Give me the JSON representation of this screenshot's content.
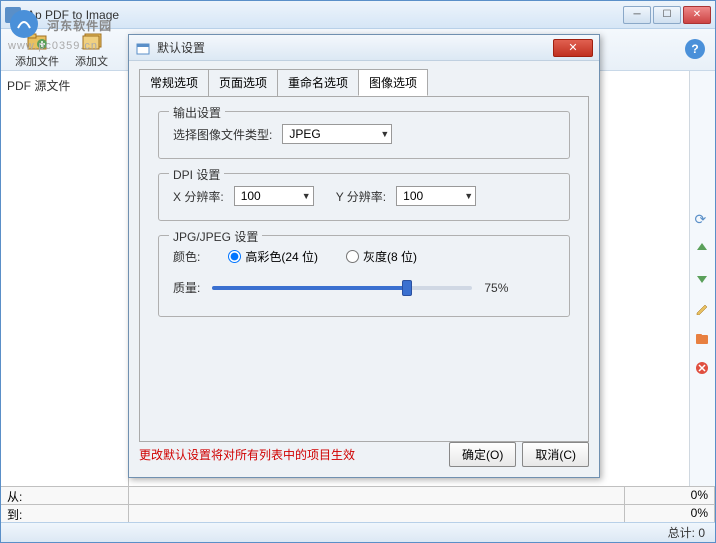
{
  "watermark": "河东软件园",
  "watermark_url": "www.pc0359.cn",
  "main": {
    "title": "Ap PDF to Image",
    "toolbar": {
      "add_file": "添加文件",
      "add_files": "添加文"
    },
    "left_header": "PDF 源文件",
    "status": {
      "from": "从:",
      "to": "到:",
      "pct": "0%",
      "total": "总计: 0"
    }
  },
  "side_icons": {
    "refresh": "refresh-icon",
    "up": "up-icon",
    "down": "down-icon",
    "edit": "edit-icon",
    "folder": "folder-icon",
    "delete": "delete-icon"
  },
  "dialog": {
    "title": "默认设置",
    "tabs": [
      "常规选项",
      "页面选项",
      "重命名选项",
      "图像选项"
    ],
    "active_tab": 3,
    "output": {
      "legend": "输出设置",
      "filetype_label": "选择图像文件类型:",
      "filetype_value": "JPEG"
    },
    "dpi": {
      "legend": "DPI 设置",
      "x_label": "X 分辨率:",
      "x_value": "100",
      "y_label": "Y 分辨率:",
      "y_value": "100"
    },
    "jpeg": {
      "legend": "JPG/JPEG 设置",
      "color_label": "颜色:",
      "color_opt1": "高彩色(24 位)",
      "color_opt2": "灰度(8 位)",
      "quality_label": "质量:",
      "quality_value": "75%",
      "quality_pct": 75
    },
    "warning": "更改默认设置将对所有列表中的项目生效",
    "ok": "确定(O)",
    "cancel": "取消(C)"
  }
}
